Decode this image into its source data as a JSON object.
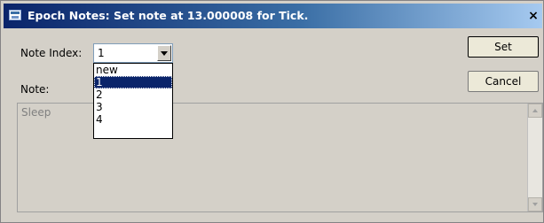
{
  "window": {
    "title": "Epoch Notes: Set note at 13.000008 for Tick.",
    "close_glyph": "×"
  },
  "form": {
    "note_index_label": "Note Index:",
    "note_index_value": "1",
    "note_label": "Note:",
    "note_text": "Sleep"
  },
  "dropdown": {
    "options": [
      "new",
      "1",
      "2",
      "3",
      "4"
    ],
    "selected": "1"
  },
  "buttons": {
    "set": "Set",
    "cancel": "Cancel"
  },
  "icons": [
    "app-window-icon",
    "close-icon",
    "chevron-down-icon",
    "scroll-up-arrow-icon",
    "scroll-down-arrow-icon"
  ],
  "colors": {
    "titlebar_start": "#0a246a",
    "titlebar_end": "#a6caf0",
    "selection": "#0a246a",
    "dialog_bg": "#d4d0c8"
  }
}
